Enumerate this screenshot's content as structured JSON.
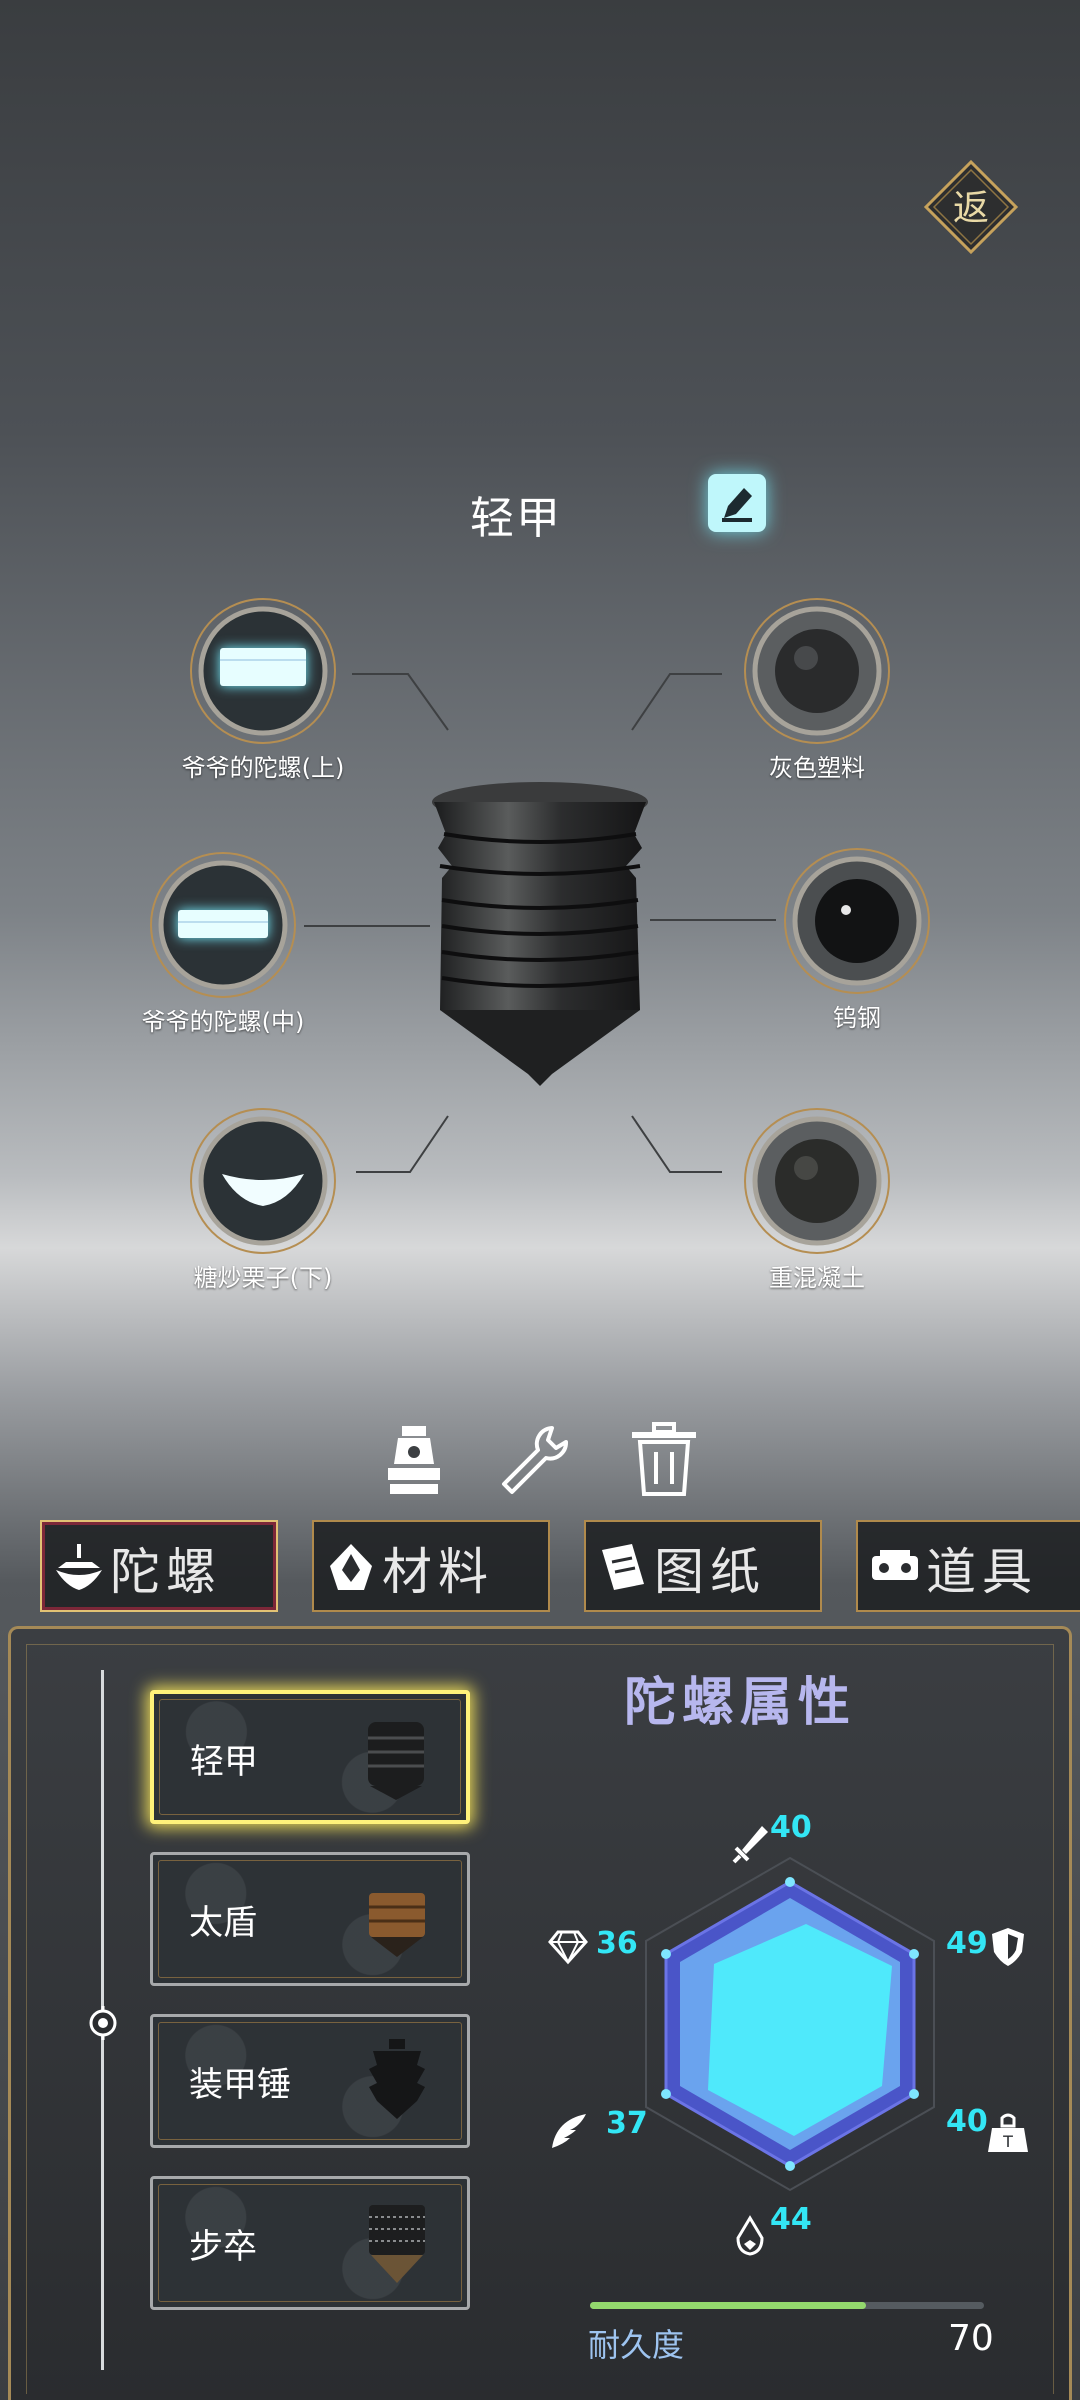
{
  "header": {
    "back_label": "返",
    "spin_top_name": "轻甲",
    "edit_icon": "pencil-icon"
  },
  "parts": [
    {
      "label": "爷爷的陀螺(上)",
      "icon": "part-band-icon"
    },
    {
      "label": "灰色塑料",
      "icon": "sphere-icon"
    },
    {
      "label": "爷爷的陀螺(中)",
      "icon": "part-band-icon"
    },
    {
      "label": "钨钢",
      "icon": "sphere-icon"
    },
    {
      "label": "糖炒栗子(下)",
      "icon": "part-bottom-icon"
    },
    {
      "label": "重混凝土",
      "icon": "sphere-icon"
    }
  ],
  "toolbar": [
    {
      "name": "assemble",
      "icon": "assemble-icon"
    },
    {
      "name": "repair",
      "icon": "wrench-icon"
    },
    {
      "name": "delete",
      "icon": "trash-icon"
    }
  ],
  "tabs": [
    {
      "label": "陀螺",
      "icon": "spin-top-icon",
      "active": true
    },
    {
      "label": "材料",
      "icon": "material-icon",
      "active": false
    },
    {
      "label": "图纸",
      "icon": "blueprint-icon",
      "active": false
    },
    {
      "label": "道具",
      "icon": "item-icon",
      "active": false
    }
  ],
  "top_list": [
    {
      "label": "轻甲",
      "selected": true
    },
    {
      "label": "太盾",
      "selected": false
    },
    {
      "label": "装甲锤",
      "selected": false
    },
    {
      "label": "步卒",
      "selected": false
    }
  ],
  "attributes": {
    "title": "陀螺属性",
    "stats": [
      {
        "icon": "sword-icon",
        "value": "40"
      },
      {
        "icon": "shield-icon",
        "value": "49"
      },
      {
        "icon": "weight-icon",
        "value": "40"
      },
      {
        "icon": "drop-icon",
        "value": "44"
      },
      {
        "icon": "feather-icon",
        "value": "37"
      },
      {
        "icon": "diamond-icon",
        "value": "36"
      }
    ],
    "durability_label": "耐久度",
    "durability_value": "70",
    "durability_fraction": 0.7,
    "colors": {
      "stat_text": "#33e6f5",
      "hex_fill": "#4fe9fb",
      "hex_border": "#5a5fd6"
    }
  }
}
